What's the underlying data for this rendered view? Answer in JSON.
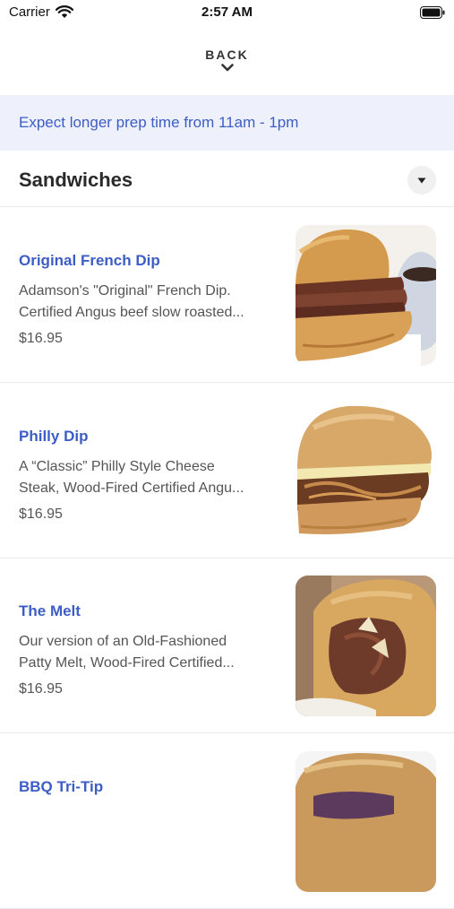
{
  "status_bar": {
    "carrier": "Carrier",
    "time": "2:57 AM"
  },
  "nav": {
    "back_label": "BACK"
  },
  "notice": {
    "text": "Expect longer prep time from 11am - 1pm"
  },
  "section": {
    "title": "Sandwiches"
  },
  "items": [
    {
      "name": "Original French Dip",
      "desc_line1": "Adamson's \"Original\" French Dip.",
      "desc_line2": "Certified Angus beef slow roasted...",
      "price": "$16.95"
    },
    {
      "name": "Philly Dip",
      "desc_line1": "A “Classic” Philly Style Cheese",
      "desc_line2": "Steak, Wood-Fired Certified Angu...",
      "price": "$16.95"
    },
    {
      "name": "The Melt",
      "desc_line1": "Our version of an Old-Fashioned",
      "desc_line2": "Patty Melt, Wood-Fired Certified...",
      "price": "$16.95"
    },
    {
      "name": "BBQ Tri-Tip"
    }
  ],
  "colors": {
    "accent": "#3c5dc4",
    "banner_bg": "#eef1fb"
  }
}
